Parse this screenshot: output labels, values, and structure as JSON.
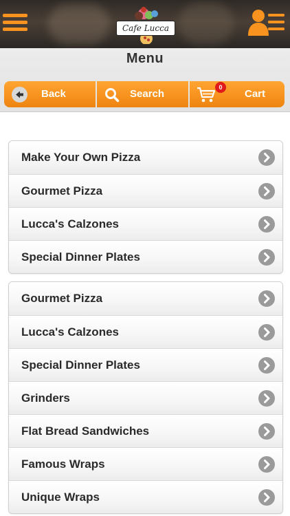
{
  "header": {
    "logo_text": "Cafe Lucca",
    "menu_icon": "hamburger-menu-icon",
    "user_icon": "user-list-icon"
  },
  "page": {
    "title": "Menu"
  },
  "nav": {
    "back_label": "Back",
    "search_label": "Search",
    "cart_label": "Cart",
    "cart_count": "0"
  },
  "colors": {
    "accent": "#f7931e",
    "badge": "#e11b1b",
    "chevron": "#9a9a9a"
  },
  "menu_groups": [
    {
      "items": [
        "Make Your Own Pizza",
        "Gourmet Pizza",
        "Lucca's Calzones",
        "Special Dinner Plates"
      ]
    },
    {
      "items": [
        "Gourmet Pizza",
        "Lucca's Calzones",
        "Special Dinner Plates",
        "Grinders",
        "Flat Bread Sandwiches",
        "Famous Wraps",
        "Unique Wraps"
      ]
    }
  ]
}
